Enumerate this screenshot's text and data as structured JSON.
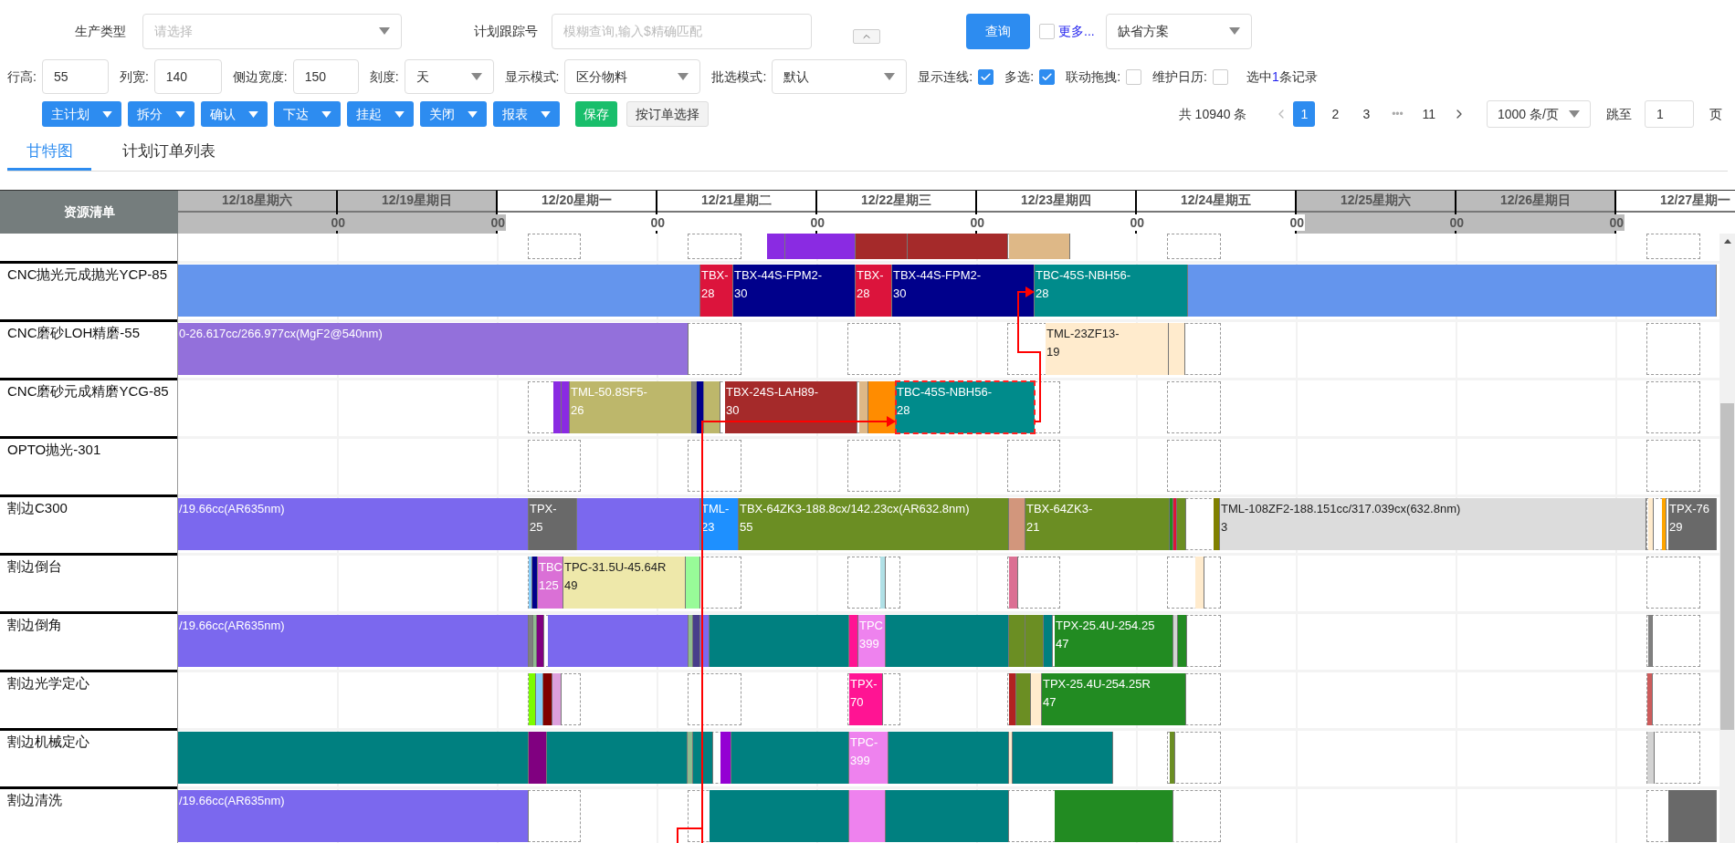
{
  "filters": {
    "production_type": {
      "label": "生产类型",
      "placeholder": "请选择"
    },
    "tracking_no": {
      "label": "计划跟踪号",
      "placeholder": "模糊查询,输入$精确匹配"
    },
    "query_button": "查询",
    "more": {
      "label": "更多...",
      "checked": false
    },
    "scheme": {
      "value": "缺省方案"
    }
  },
  "settings": [
    {
      "kind": "input",
      "label": "行高:",
      "value": "55"
    },
    {
      "kind": "input",
      "label": "列宽:",
      "value": "140"
    },
    {
      "kind": "input",
      "label": "侧边宽度:",
      "value": "150"
    },
    {
      "kind": "select",
      "label": "刻度:",
      "value": "天"
    },
    {
      "kind": "select",
      "label": "显示模式:",
      "value": "区分物料"
    },
    {
      "kind": "select",
      "label": "批选模式:",
      "value": "默认"
    },
    {
      "kind": "checkbox",
      "label": "显示连线:",
      "checked": true
    },
    {
      "kind": "checkbox",
      "label": "多选:",
      "checked": true
    },
    {
      "kind": "checkbox",
      "label": "联动拖拽:",
      "checked": false
    },
    {
      "kind": "checkbox",
      "label": "维护日历:",
      "checked": false
    }
  ],
  "selection_note": {
    "prefix": "选中",
    "count": "1",
    "suffix": "条记录"
  },
  "actions": [
    {
      "label": "主计划",
      "kind": "dropdown"
    },
    {
      "label": "拆分",
      "kind": "dropdown"
    },
    {
      "label": "确认",
      "kind": "dropdown"
    },
    {
      "label": "下达",
      "kind": "dropdown"
    },
    {
      "label": "挂起",
      "kind": "dropdown"
    },
    {
      "label": "关闭",
      "kind": "dropdown"
    },
    {
      "label": "报表",
      "kind": "dropdown"
    },
    {
      "label": "保存",
      "kind": "save"
    },
    {
      "label": "按订单选择",
      "kind": "plain"
    }
  ],
  "pagination": {
    "total": "共 10940 条",
    "pages": [
      {
        "label": "1",
        "kind": "page",
        "selected": true
      },
      {
        "label": "2",
        "kind": "page",
        "selected": false
      },
      {
        "label": "3",
        "kind": "page",
        "selected": false
      },
      {
        "label": "•••",
        "kind": "ellipsis",
        "selected": false
      },
      {
        "label": "11",
        "kind": "page",
        "selected": false
      }
    ],
    "page_size": "1000 条/页",
    "jump_label": "跳至",
    "jump_value": "1",
    "page_suffix": "页"
  },
  "tabs": [
    {
      "label": "甘特图",
      "selected": true
    },
    {
      "label": "计划订单列表",
      "selected": false
    }
  ],
  "gantt": {
    "resource_header": "资源清单",
    "days": [
      {
        "label": "12/18星期六",
        "tick": "00",
        "weekend": true
      },
      {
        "label": "12/19星期日",
        "tick": "00",
        "weekend": true
      },
      {
        "label": "12/20星期一",
        "tick": "00",
        "weekend": false
      },
      {
        "label": "12/21星期二",
        "tick": "00",
        "weekend": false
      },
      {
        "label": "12/22星期三",
        "tick": "00",
        "weekend": false
      },
      {
        "label": "12/23星期四",
        "tick": "00",
        "weekend": false
      },
      {
        "label": "12/24星期五",
        "tick": "00",
        "weekend": false
      },
      {
        "label": "12/25星期六",
        "tick": "00",
        "weekend": true
      },
      {
        "label": "12/26星期日",
        "tick": "00",
        "weekend": true
      },
      {
        "label": "12/27星期一",
        "weekend": false
      }
    ],
    "rows": [
      {
        "bars": [
          {
            "color": "#8a2be2",
            "selected": false
          },
          {
            "color": "#8a2be2",
            "selected": false
          },
          {
            "color": "#a52a2a",
            "selected": false
          },
          {
            "color": "#a52a2a",
            "selected": false
          },
          {
            "color": "#deb887",
            "selected": false
          }
        ]
      },
      {
        "name": "CNC抛光元成抛光YCP-85",
        "bars": [
          {
            "color": "#6495ed",
            "selected": false
          },
          {
            "color": "#dc143c",
            "lines": [
              "TBX-",
              "28"
            ],
            "selected": false
          },
          {
            "color": "#00008b",
            "lines": [
              "TBX-44S-FPM2-",
              "30"
            ],
            "selected": false
          },
          {
            "color": "#dc143c",
            "lines": [
              "TBX-",
              "28"
            ],
            "selected": false
          },
          {
            "color": "#00008b",
            "lines": [
              "TBX-44S-FPM2-",
              "30"
            ],
            "selected": false
          },
          {
            "color": "#008b8b",
            "lines": [
              "TBC-45S-NBH56-",
              "28"
            ],
            "selected": false
          },
          {
            "color": "#6495ed",
            "selected": false
          }
        ]
      },
      {
        "name": "CNC磨砂LOH精磨-55",
        "bars": [
          {
            "color": "#9370db",
            "lines": [
              "0-26.617cc/266.977cx(MgF2@540nm)"
            ],
            "selected": false
          },
          {
            "color": "#ffebcd",
            "lines": [
              "TML-23ZF13-",
              "19"
            ],
            "selected": false
          },
          {
            "color": "#ffebcd",
            "selected": false
          }
        ]
      },
      {
        "name": "CNC磨砂元成精磨YCG-85",
        "bars": [
          {
            "color": "#8a2be2",
            "selected": false
          },
          {
            "color": "#8a2be2",
            "selected": false
          },
          {
            "color": "#bdb76b",
            "lines": [
              "TML-50.8SF5-",
              "26"
            ],
            "selected": false
          },
          {
            "color": "#808080",
            "selected": false
          },
          {
            "color": "#00008b",
            "selected": false
          },
          {
            "color": "#bdb76b",
            "selected": false
          },
          {
            "color": "#a52a2a",
            "lines": [
              "TBX-24S-LAH89-",
              "30"
            ],
            "selected": false
          },
          {
            "color": "#deb887",
            "selected": false
          },
          {
            "color": "#ff8c00",
            "selected": false
          },
          {
            "color": "#008b8b",
            "lines": [
              "TBC-45S-NBH56-",
              "28"
            ],
            "selected": true
          }
        ]
      },
      {
        "name": "OPTO抛光-301",
        "bars": []
      },
      {
        "name": "割边C300",
        "bars": [
          {
            "color": "#7b68ee",
            "lines": [
              "/19.66cc(AR635nm)"
            ],
            "selected": false
          },
          {
            "color": "#696969",
            "lines": [
              "TPX-",
              "25"
            ],
            "selected": false
          },
          {
            "color": "#7b68ee",
            "selected": false
          },
          {
            "color": "#1e90ff",
            "lines": [
              "TML-",
              "23"
            ],
            "selected": false
          },
          {
            "color": "#6b8e23",
            "lines": [
              "TBX-64ZK3-188.8cx/142.23cx(AR632.8nm)",
              "55"
            ],
            "selected": false
          },
          {
            "color": "#d2967c",
            "selected": false
          },
          {
            "color": "#6b8e23",
            "lines": [
              "TBX-64ZK3-",
              "21"
            ],
            "selected": false
          },
          {
            "color": "#228b22",
            "selected": false
          },
          {
            "color": "#dc143c",
            "selected": false
          },
          {
            "color": "#6b8e23",
            "selected": false
          },
          {
            "color": "#808000",
            "selected": false
          },
          {
            "color": "#dcdcdc",
            "lines": [
              "TML-108ZF2-188.151cc/317.039cx(632.8nm)",
              "3"
            ],
            "selected": false
          },
          {
            "color": "#ffebcd",
            "selected": false
          },
          {
            "color": "#ffa500",
            "selected": false
          },
          {
            "color": "#696969",
            "lines": [
              "TPX-76",
              "29"
            ],
            "selected": false
          }
        ]
      },
      {
        "name": "割边倒台",
        "bars": [
          {
            "color": "#87cefa",
            "selected": false
          },
          {
            "color": "#00008b",
            "selected": false
          },
          {
            "color": "#da70d6",
            "lines": [
              "TBC",
              "125"
            ],
            "selected": false
          },
          {
            "color": "#eee8aa",
            "lines": [
              "TPC-31.5U-45.64R",
              "49"
            ],
            "selected": false
          },
          {
            "color": "#98fb98",
            "selected": false
          },
          {
            "color": "#b0e0e6",
            "selected": false
          },
          {
            "color": "#db7093",
            "selected": false
          },
          {
            "color": "#ffebcd",
            "selected": false
          }
        ]
      },
      {
        "name": "割边倒角",
        "bars": [
          {
            "color": "#7b68ee",
            "lines": [
              "/19.66cc(AR635nm)"
            ],
            "selected": false
          },
          {
            "color": "#808080",
            "selected": false
          },
          {
            "color": "#8fbc8f",
            "selected": false
          },
          {
            "color": "#800080",
            "selected": false
          },
          {
            "color": "#7b68ee",
            "selected": false
          },
          {
            "color": "#8fbc8f",
            "selected": false
          },
          {
            "color": "#483d8b",
            "selected": false
          },
          {
            "color": "#7b68ee",
            "selected": false
          },
          {
            "color": "#008080",
            "selected": false
          },
          {
            "color": "#ff1493",
            "selected": false
          },
          {
            "color": "#ee82ee",
            "lines": [
              "TPC",
              "399"
            ],
            "selected": false
          },
          {
            "color": "#008080",
            "selected": false
          },
          {
            "color": "#6b8e23",
            "selected": false
          },
          {
            "color": "#6b8e23",
            "selected": false
          },
          {
            "color": "#008080",
            "selected": false
          },
          {
            "color": "#228b22",
            "lines": [
              "TPX-25.4U-254.25",
              "47"
            ],
            "selected": false
          },
          {
            "color": "#d3d3d3",
            "selected": false
          },
          {
            "color": "#228b22",
            "selected": false
          },
          {
            "color": "#808080",
            "selected": false
          }
        ]
      },
      {
        "name": "割边光学定心",
        "bars": [
          {
            "color": "#7cfc00",
            "selected": false
          },
          {
            "color": "#87cefa",
            "selected": false
          },
          {
            "color": "#800000",
            "selected": false
          },
          {
            "color": "#dda0dd",
            "selected": false
          },
          {
            "color": "#ff1493",
            "lines": [
              "TPX-",
              "70"
            ],
            "selected": false
          },
          {
            "color": "#b22222",
            "selected": false
          },
          {
            "color": "#6b8e23",
            "selected": false
          },
          {
            "color": "#ffebcd",
            "selected": false
          },
          {
            "color": "#228b22",
            "lines": [
              "TPX-25.4U-254.25R",
              "47"
            ],
            "selected": false
          },
          {
            "color": "#cd5c5c",
            "selected": false
          }
        ]
      },
      {
        "name": "割边机械定心",
        "bars": [
          {
            "color": "#008080",
            "selected": false
          },
          {
            "color": "#800080",
            "selected": false
          },
          {
            "color": "#008080",
            "selected": false
          },
          {
            "color": "#8fbc8f",
            "selected": false
          },
          {
            "color": "#008080",
            "selected": false
          },
          {
            "color": "#9400d3",
            "selected": false
          },
          {
            "color": "#008080",
            "selected": false
          },
          {
            "color": "#ee82ee",
            "lines": [
              "TPC-",
              "399"
            ],
            "selected": false
          },
          {
            "color": "#008080",
            "selected": false
          },
          {
            "color": "#ffebcd",
            "selected": false
          },
          {
            "color": "#008080",
            "selected": false
          },
          {
            "color": "#6b8e23",
            "selected": false
          },
          {
            "color": "#d3d3d3",
            "selected": false
          }
        ]
      },
      {
        "name": "割边清洗",
        "bars": [
          {
            "color": "#7b68ee",
            "lines": [
              "/19.66cc(AR635nm)"
            ],
            "selected": false
          },
          {
            "color": "#008080",
            "selected": false
          },
          {
            "color": "#ee82ee",
            "selected": false
          },
          {
            "color": "#008080",
            "selected": false
          },
          {
            "color": "#228b22",
            "selected": false
          },
          {
            "color": "#696969",
            "selected": false
          }
        ]
      }
    ]
  }
}
